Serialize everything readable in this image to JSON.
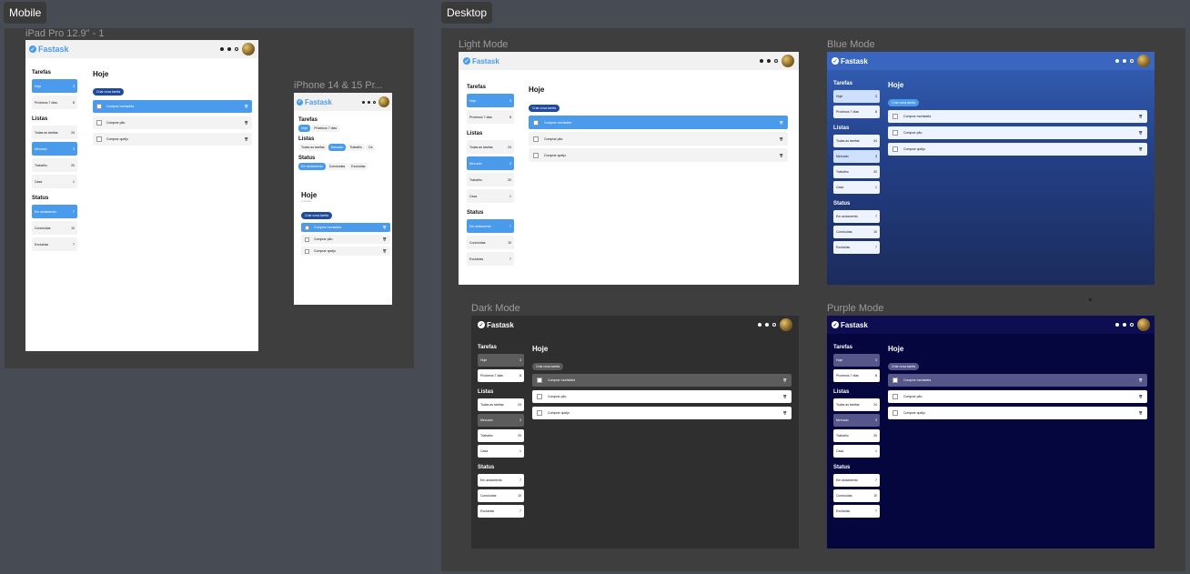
{
  "labels": {
    "mobile": "Mobile",
    "desktop": "Desktop"
  },
  "frames": {
    "ipad": "iPad Pro 12.9\" - 1",
    "iphone": "iPhone 14 & 15 Pr...",
    "light": "Light Mode",
    "blue": "Blue Mode",
    "dark": "Dark Mode",
    "purple": "Purple Mode"
  },
  "app": {
    "brand": "Fastask",
    "sections": {
      "tarefas": "Tarefas",
      "listas": "Listas",
      "status": "Status"
    },
    "tarefas": [
      {
        "label": "Hoje",
        "count": "3"
      },
      {
        "label": "Próximos 7 dias",
        "count": "8"
      }
    ],
    "listas": [
      {
        "label": "Todas as tarefas",
        "count": "24"
      },
      {
        "label": "Mercado",
        "count": "3"
      },
      {
        "label": "Trabalho",
        "count": "20"
      },
      {
        "label": "Casa",
        "count": "1"
      }
    ],
    "status": [
      {
        "label": "Em andamento",
        "count": "7"
      },
      {
        "label": "Concluídas",
        "count": "10"
      },
      {
        "label": "Excluídas",
        "count": "7"
      }
    ],
    "main_title": "Hoje",
    "create_button": "Criar nova tarefa",
    "tasks": [
      "Comprar morfadela",
      "Comprar pão",
      "Comprar queijo"
    ],
    "phone_subtitle": "3 tarefas",
    "phone_tarefas": [
      "Hoje",
      "Próximos 7 dias"
    ],
    "phone_listas": [
      "Todas as tarefas",
      "Mercado",
      "Trabalho",
      "Ca"
    ],
    "phone_status": [
      "Em andamento",
      "Concluídas",
      "Excluídas"
    ]
  },
  "colors": {
    "canvas": "#474c54",
    "section": "#3e3e3e",
    "accent_blue": "#4a9bec",
    "blue_mode_start": "#3461b8",
    "blue_mode_end": "#1b2c5c",
    "dark_mode": "#2f2f2f",
    "purple_mode": "#06063f",
    "create_button_blue": "#1f4aa0"
  }
}
